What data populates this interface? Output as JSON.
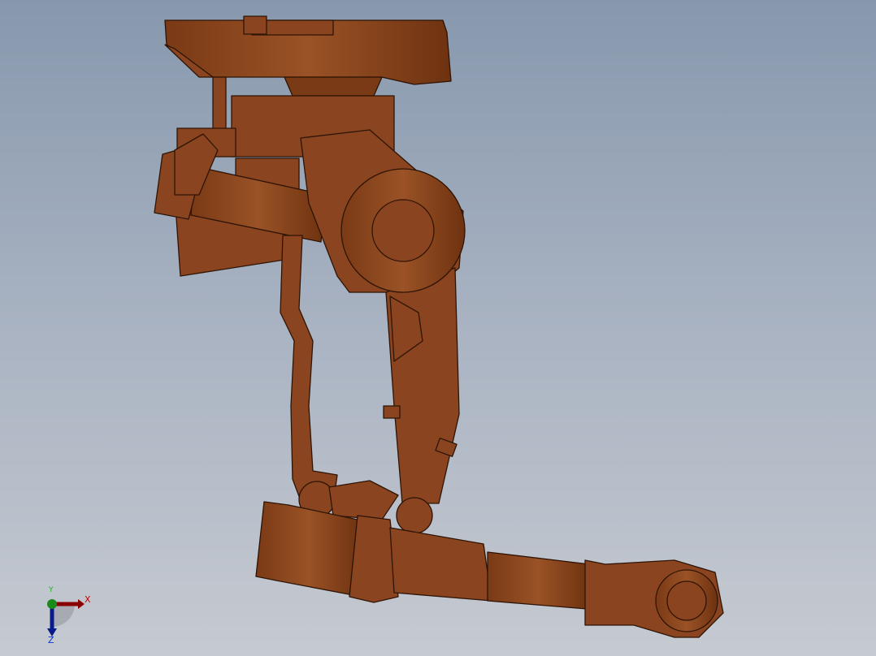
{
  "viewport": {
    "model": "robot-arm-assembly"
  },
  "triad": {
    "x_label": "X",
    "y_label": "Y",
    "z_label": "Z",
    "x_color": "#b00000",
    "y_color": "#1a9a1a",
    "z_color": "#1020a0"
  },
  "colors": {
    "part": "#8a4520",
    "part_dark": "#6e3412",
    "edge": "#2e1405"
  }
}
